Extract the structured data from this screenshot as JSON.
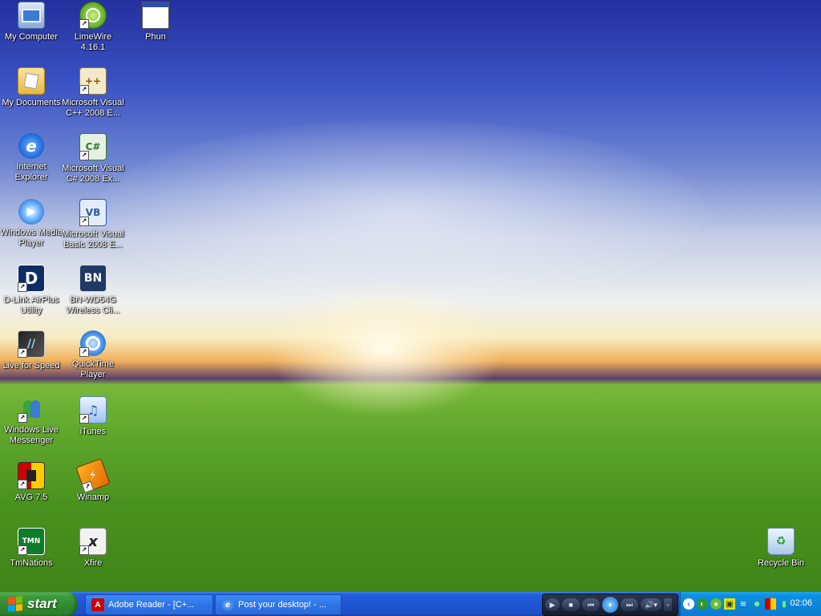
{
  "desktop_icons": [
    {
      "label": "My Computer",
      "icon": "computer-icon"
    },
    {
      "label": "LimeWire 4.16.1",
      "icon": "limewire-icon"
    },
    {
      "label": "Phun",
      "icon": "phun-icon"
    },
    {
      "label": "My Documents",
      "icon": "folder-icon"
    },
    {
      "label": "Microsoft Visual C++ 2008 E...",
      "icon": "visual-cpp-icon"
    },
    {
      "label": "Internet Explorer",
      "icon": "internet-explorer-icon"
    },
    {
      "label": "Microsoft Visual C# 2008 Ex...",
      "icon": "visual-csharp-icon"
    },
    {
      "label": "Windows Media Player",
      "icon": "media-player-icon"
    },
    {
      "label": "Microsoft Visual Basic 2008 E...",
      "icon": "visual-basic-icon"
    },
    {
      "label": "D-Link AirPlus Utility",
      "icon": "dlink-icon"
    },
    {
      "label": "BN-WD54G Wireless Cli...",
      "icon": "bn-wireless-icon"
    },
    {
      "label": "Live for Speed",
      "icon": "live-for-speed-icon"
    },
    {
      "label": "QuickTime Player",
      "icon": "quicktime-icon"
    },
    {
      "label": "Windows Live Messenger",
      "icon": "messenger-icon"
    },
    {
      "label": "iTunes",
      "icon": "itunes-icon"
    },
    {
      "label": "AVG 7.5",
      "icon": "avg-icon"
    },
    {
      "label": "Winamp",
      "icon": "winamp-icon"
    },
    {
      "label": "TmNations",
      "icon": "tmnations-icon"
    },
    {
      "label": "Xfire",
      "icon": "xfire-icon"
    },
    {
      "label": "Recycle Bin",
      "icon": "recycle-bin-icon"
    }
  ],
  "icon_glyphs": {
    "dlink": "D",
    "bn": "BN",
    "vcpp": "++",
    "vcs": "C#",
    "vb": "VB",
    "tmn": "TMN",
    "lfs": "//",
    "xfire": "x"
  },
  "taskbar": {
    "start_label": "start",
    "tasks": [
      {
        "label": "Adobe Reader - [C+...",
        "icon": "adobe-reader-icon"
      },
      {
        "label": "Post your desktop! - ...",
        "icon": "internet-explorer-icon"
      }
    ],
    "media_controls": {
      "play_glyph": "▶",
      "stop_glyph": "■",
      "prev_glyph": "⏮",
      "pause_glyph": "⏸",
      "next_glyph": "⏭",
      "volume_glyph": "🔊▾"
    },
    "tray": {
      "expand_glyph": "‹",
      "clock": "02:06"
    }
  },
  "colors": {
    "taskbar_blue": "#245edb",
    "start_green": "#3c9a3c",
    "tray_blue": "#0f8fe0"
  }
}
